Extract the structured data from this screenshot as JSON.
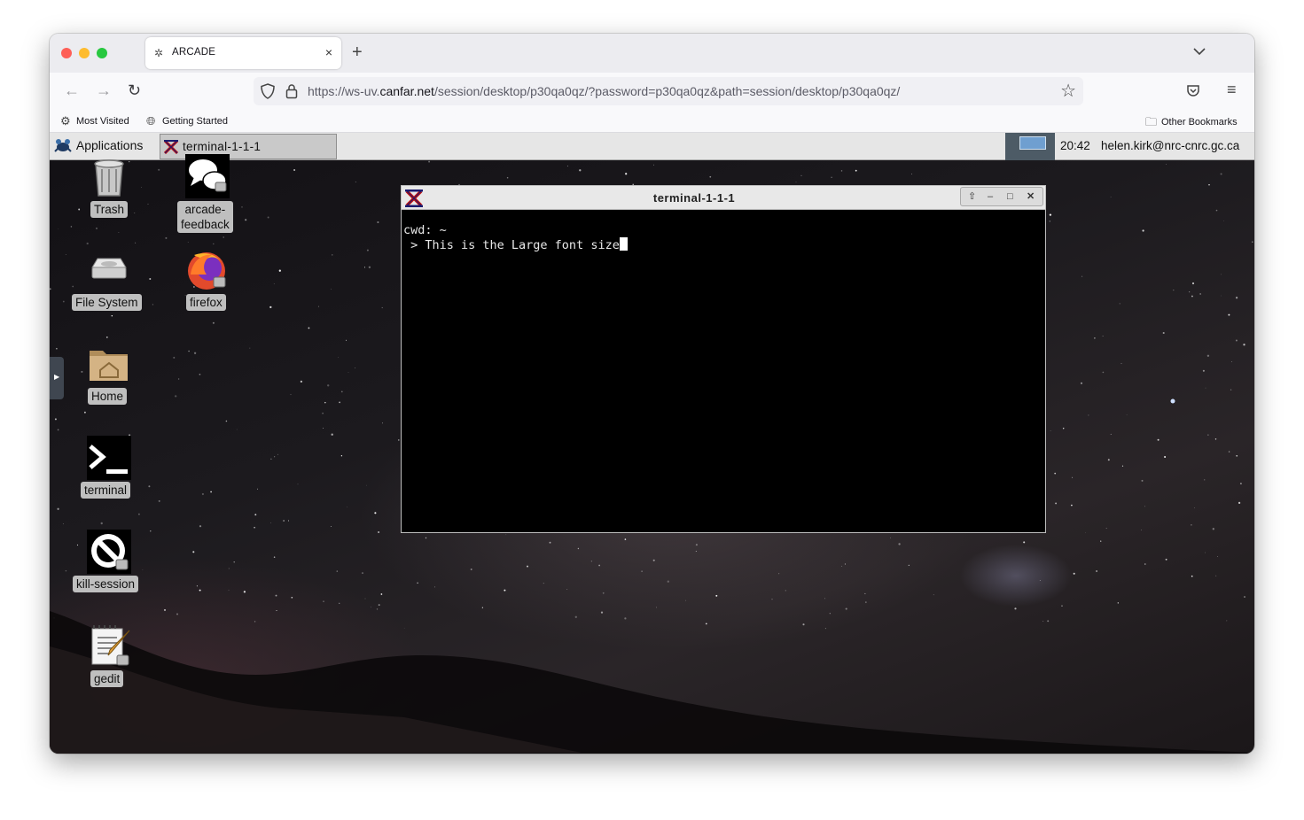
{
  "browser": {
    "tab_title": "ARCADE",
    "tab_close": "×",
    "new_tab": "+",
    "tab_list": "⌄",
    "url_prefix": "https://ws-uv.",
    "url_domain": "canfar.net",
    "url_path": "/session/desktop/p30qa0qz/?password=p30qa0qz&path=session/desktop/p30qa0qz/",
    "back": "←",
    "forward": "→",
    "reload": "↻",
    "bookmark_star": "☆",
    "menu": "≡"
  },
  "bookmarks": {
    "most_visited": "Most Visited",
    "getting_started": "Getting Started",
    "other": "Other Bookmarks"
  },
  "panel": {
    "applications": "Applications",
    "task_label": "terminal-1-1-1",
    "clock": "20:42",
    "user": "helen.kirk@nrc-cnrc.gc.ca"
  },
  "desktop_icons": {
    "trash": "Trash",
    "arcade_feedback_1": "arcade-",
    "arcade_feedback_2": "feedback",
    "file_system": "File System",
    "firefox": "firefox",
    "home": "Home",
    "terminal": "terminal",
    "kill_session": "kill-session",
    "gedit": "gedit"
  },
  "terminal": {
    "title": "terminal-1-1-1",
    "line1": "cwd: ~",
    "line2": " > This is the Large font size"
  },
  "colors": {
    "panel_bg": "#e6e6e6",
    "terminal_bg": "#000000",
    "workspace": "#6f9fd0"
  }
}
